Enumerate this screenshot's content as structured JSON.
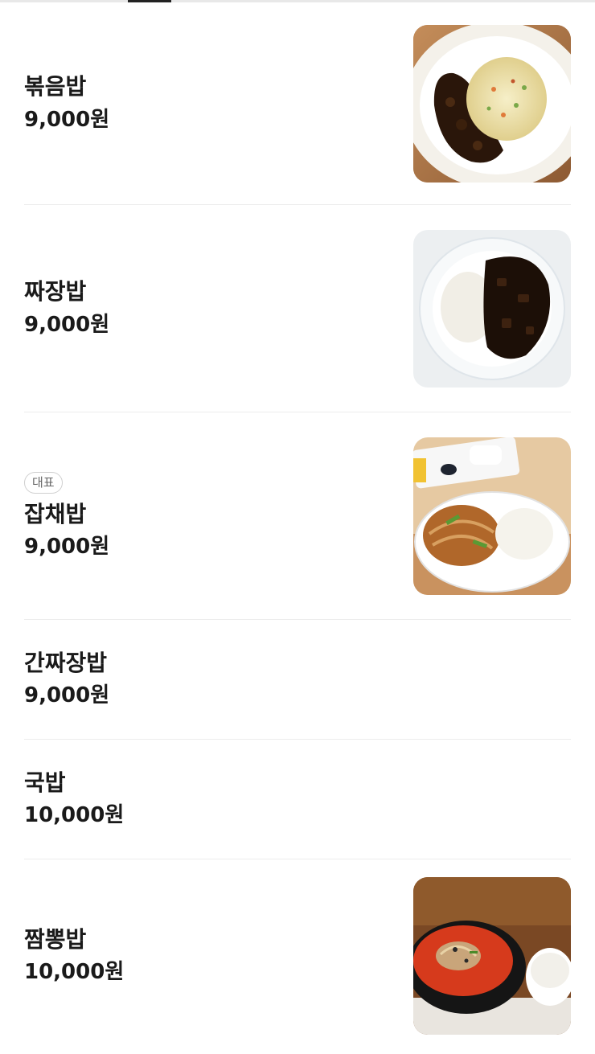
{
  "menu": {
    "items": [
      {
        "name": "볶음밥",
        "price": "9,000원",
        "badge": "",
        "image": "fried-rice-photo"
      },
      {
        "name": "짜장밥",
        "price": "9,000원",
        "badge": "",
        "image": "jjajang-rice-photo"
      },
      {
        "name": "잡채밥",
        "price": "9,000원",
        "badge": "대표",
        "image": "japchae-rice-photo"
      },
      {
        "name": "간짜장밥",
        "price": "9,000원",
        "badge": "",
        "image": ""
      },
      {
        "name": "국밥",
        "price": "10,000원",
        "badge": "",
        "image": ""
      },
      {
        "name": "짬뽕밥",
        "price": "10,000원",
        "badge": "",
        "image": "jjamppong-rice-photo"
      }
    ]
  },
  "colors": {
    "text": "#1a1a1a",
    "divider": "#ececec",
    "badge_border": "#cfcfcf"
  }
}
